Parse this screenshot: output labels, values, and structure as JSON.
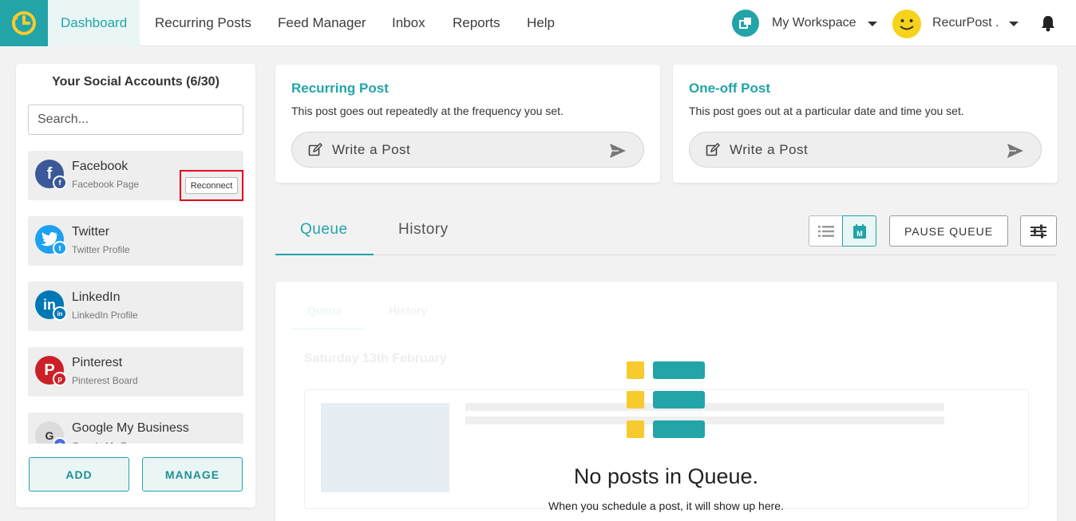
{
  "nav": {
    "items": [
      {
        "label": "Dashboard",
        "active": true
      },
      {
        "label": "Recurring Posts"
      },
      {
        "label": "Feed Manager"
      },
      {
        "label": "Inbox"
      },
      {
        "label": "Reports"
      },
      {
        "label": "Help"
      }
    ],
    "workspace_label": "My Workspace",
    "user_label": "RecurPost ."
  },
  "accounts_panel": {
    "title": "Your Social Accounts (6/30)",
    "search_placeholder": "Search...",
    "accounts": [
      {
        "name": "Facebook",
        "type": "Facebook Page",
        "icon": "facebook-icon",
        "color": "#3b5998",
        "action": "Reconnect"
      },
      {
        "name": "Twitter",
        "type": "Twitter Profile",
        "icon": "twitter-icon",
        "color": "#1da1f2"
      },
      {
        "name": "LinkedIn",
        "type": "LinkedIn Profile",
        "icon": "linkedin-icon",
        "color": "#0077b5"
      },
      {
        "name": "Pinterest",
        "type": "Pinterest Board",
        "icon": "pinterest-icon",
        "color": "#cb2027"
      },
      {
        "name": "Google My Business",
        "type": "Google My B...",
        "icon": "google-my-business-icon",
        "color": "#4a6ee0"
      }
    ],
    "add_label": "ADD",
    "manage_label": "MANAGE"
  },
  "recurring_card": {
    "title": "Recurring Post",
    "description": "This post goes out repeatedly at the frequency you set.",
    "button_label": "Write a Post"
  },
  "oneoff_card": {
    "title": "One-off Post",
    "description": "This post goes out at a particular date and time you set.",
    "button_label": "Write a Post"
  },
  "tabs": [
    {
      "label": "Queue",
      "active": true
    },
    {
      "label": "History"
    }
  ],
  "toolbar": {
    "pause_label": "PAUSE QUEUE",
    "calendar_letter": "M"
  },
  "queue": {
    "ghost_tabs": [
      "Queue",
      "History"
    ],
    "ghost_date": "Saturday 13th February",
    "empty_title": "No posts in Queue.",
    "empty_subtitle": "When you schedule a post, it will show up here."
  },
  "colors": {
    "accent": "#22a4a8",
    "highlight_border": "#e3001b",
    "illustration_yellow": "#f7cb2d"
  }
}
